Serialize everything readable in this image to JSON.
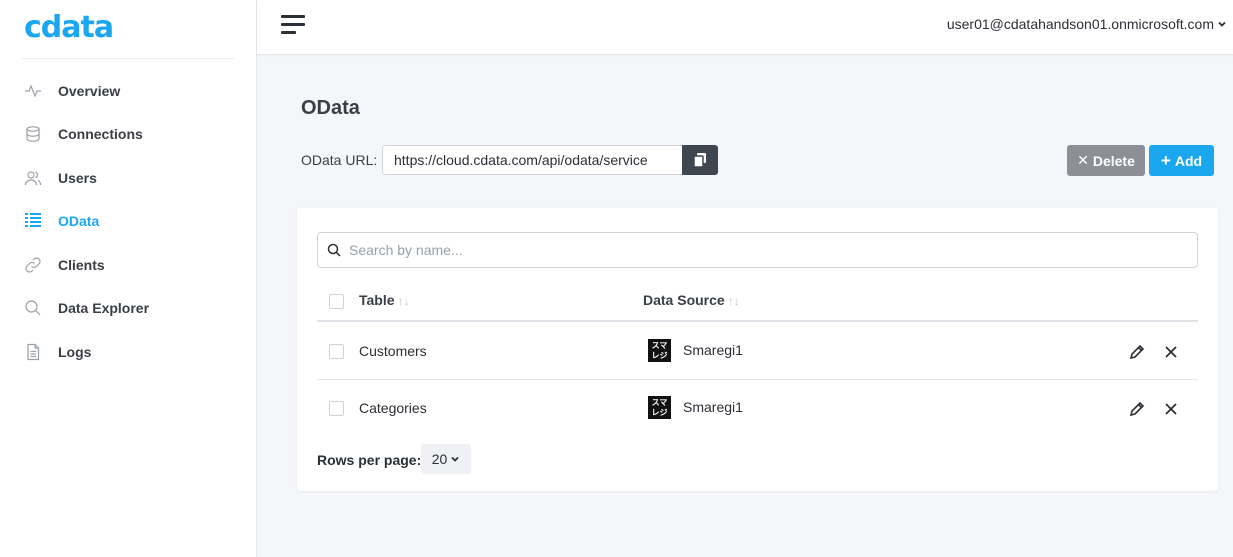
{
  "brand": {
    "logo_text": "cdata",
    "accent": "#1aa7f0"
  },
  "sidebar": {
    "items": [
      {
        "label": "Overview",
        "icon": "activity-icon"
      },
      {
        "label": "Connections",
        "icon": "database-icon"
      },
      {
        "label": "Users",
        "icon": "users-icon"
      },
      {
        "label": "OData",
        "icon": "odata-icon",
        "active": true
      },
      {
        "label": "Clients",
        "icon": "link-icon"
      },
      {
        "label": "Data Explorer",
        "icon": "search-icon"
      },
      {
        "label": "Logs",
        "icon": "document-icon"
      }
    ]
  },
  "header": {
    "user": "user01@cdatahandson01.onmicrosoft.com"
  },
  "main": {
    "title": "OData",
    "url_label": "OData URL:",
    "url_value": "https://cloud.cdata.com/api/odata/service",
    "delete_label": "Delete",
    "add_label": "Add",
    "search_placeholder": "Search by name...",
    "columns": {
      "table": "Table",
      "data_source": "Data Source"
    },
    "rows": [
      {
        "table": "Customers",
        "data_source": "Smaregi1"
      },
      {
        "table": "Categories",
        "data_source": "Smaregi1"
      }
    ],
    "ds_logo_text": [
      "スマ",
      "レジ"
    ],
    "rows_per_page_label": "Rows per page:",
    "rows_per_page_value": "20"
  }
}
